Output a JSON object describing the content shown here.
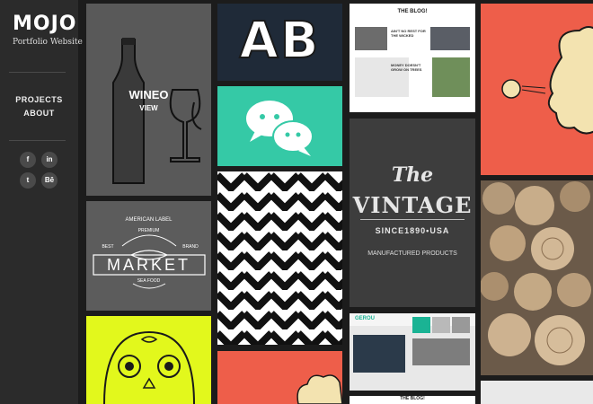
{
  "sidebar": {
    "logo": "MOJO",
    "tagline": "Portfolio Website",
    "nav": [
      {
        "label": "PROJECTS"
      },
      {
        "label": "ABOUT"
      }
    ],
    "social": [
      {
        "icon": "facebook-icon",
        "glyph": "f"
      },
      {
        "icon": "linkedin-icon",
        "glyph": "in"
      },
      {
        "icon": "twitter-icon",
        "glyph": "t"
      },
      {
        "icon": "behance-icon",
        "glyph": "Bē"
      }
    ]
  },
  "tiles": {
    "wineo": {
      "title": "WINEO",
      "action": "VIEW"
    },
    "ab": {
      "letters": "AB"
    },
    "market": {
      "top": "AMERICAN LABEL",
      "premium": "PREMIUM",
      "best": "BEST",
      "brand": "BRAND",
      "word": "MARKET",
      "bottom": "SEA FOOD"
    },
    "blog": {
      "title": "THE BLOG!",
      "post1": "AIN'T NO REST FOR THE WICKED",
      "post2": "MONEY DOESN'T GROW ON TREES"
    },
    "vintage": {
      "the": "The",
      "word": "VINTAGE",
      "since": "SINCE1890•USA",
      "made": "MANUFACTURED PRODUCTS"
    },
    "gerou": {
      "title": "GEROU"
    },
    "blog2": {
      "title": "THE BLOG!"
    }
  },
  "colors": {
    "sidebar": "#2b2b2b",
    "tile_grey": "#5a5a5a",
    "navy": "#1f2a38",
    "teal": "#35c9a6",
    "coral": "#ee5e4a",
    "lime": "#e2f81c",
    "dark_grey": "#3d3d3d"
  }
}
